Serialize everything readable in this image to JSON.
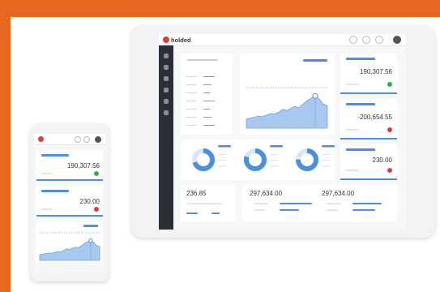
{
  "app": {
    "name": "holded"
  },
  "colors": {
    "accent": "#4a8fe2",
    "background_border": "#e8671e",
    "positive": "#2bb24c",
    "negative": "#e03a3a",
    "sidebar": "#2c2f36"
  },
  "tablet": {
    "kpis": [
      {
        "value": "190,307.56",
        "status": "positive"
      },
      {
        "value": "-200,654.55",
        "status": "negative"
      },
      {
        "value": "230.00",
        "status": "negative"
      }
    ],
    "bottom_values": [
      "236.85",
      "297,634.00",
      "297,634.00"
    ]
  },
  "phone": {
    "kpis": [
      {
        "value": "190,307.56",
        "status": "positive"
      },
      {
        "value": "230.00",
        "status": "negative"
      }
    ]
  },
  "chart_data": {
    "type": "area",
    "x": [
      0,
      1,
      2,
      3,
      4,
      5,
      6,
      7,
      8,
      9,
      10,
      11,
      12,
      13,
      14,
      15,
      16,
      17,
      18,
      19,
      20
    ],
    "values": [
      18,
      20,
      22,
      24,
      23,
      26,
      29,
      28,
      32,
      38,
      35,
      40,
      43,
      41,
      48,
      55,
      60,
      64,
      58,
      48,
      45
    ],
    "ylim": [
      0,
      100
    ],
    "highlight_index": 17
  },
  "donut_data": [
    {
      "value": 0.7
    },
    {
      "value": 0.8
    },
    {
      "value": 0.75
    }
  ]
}
